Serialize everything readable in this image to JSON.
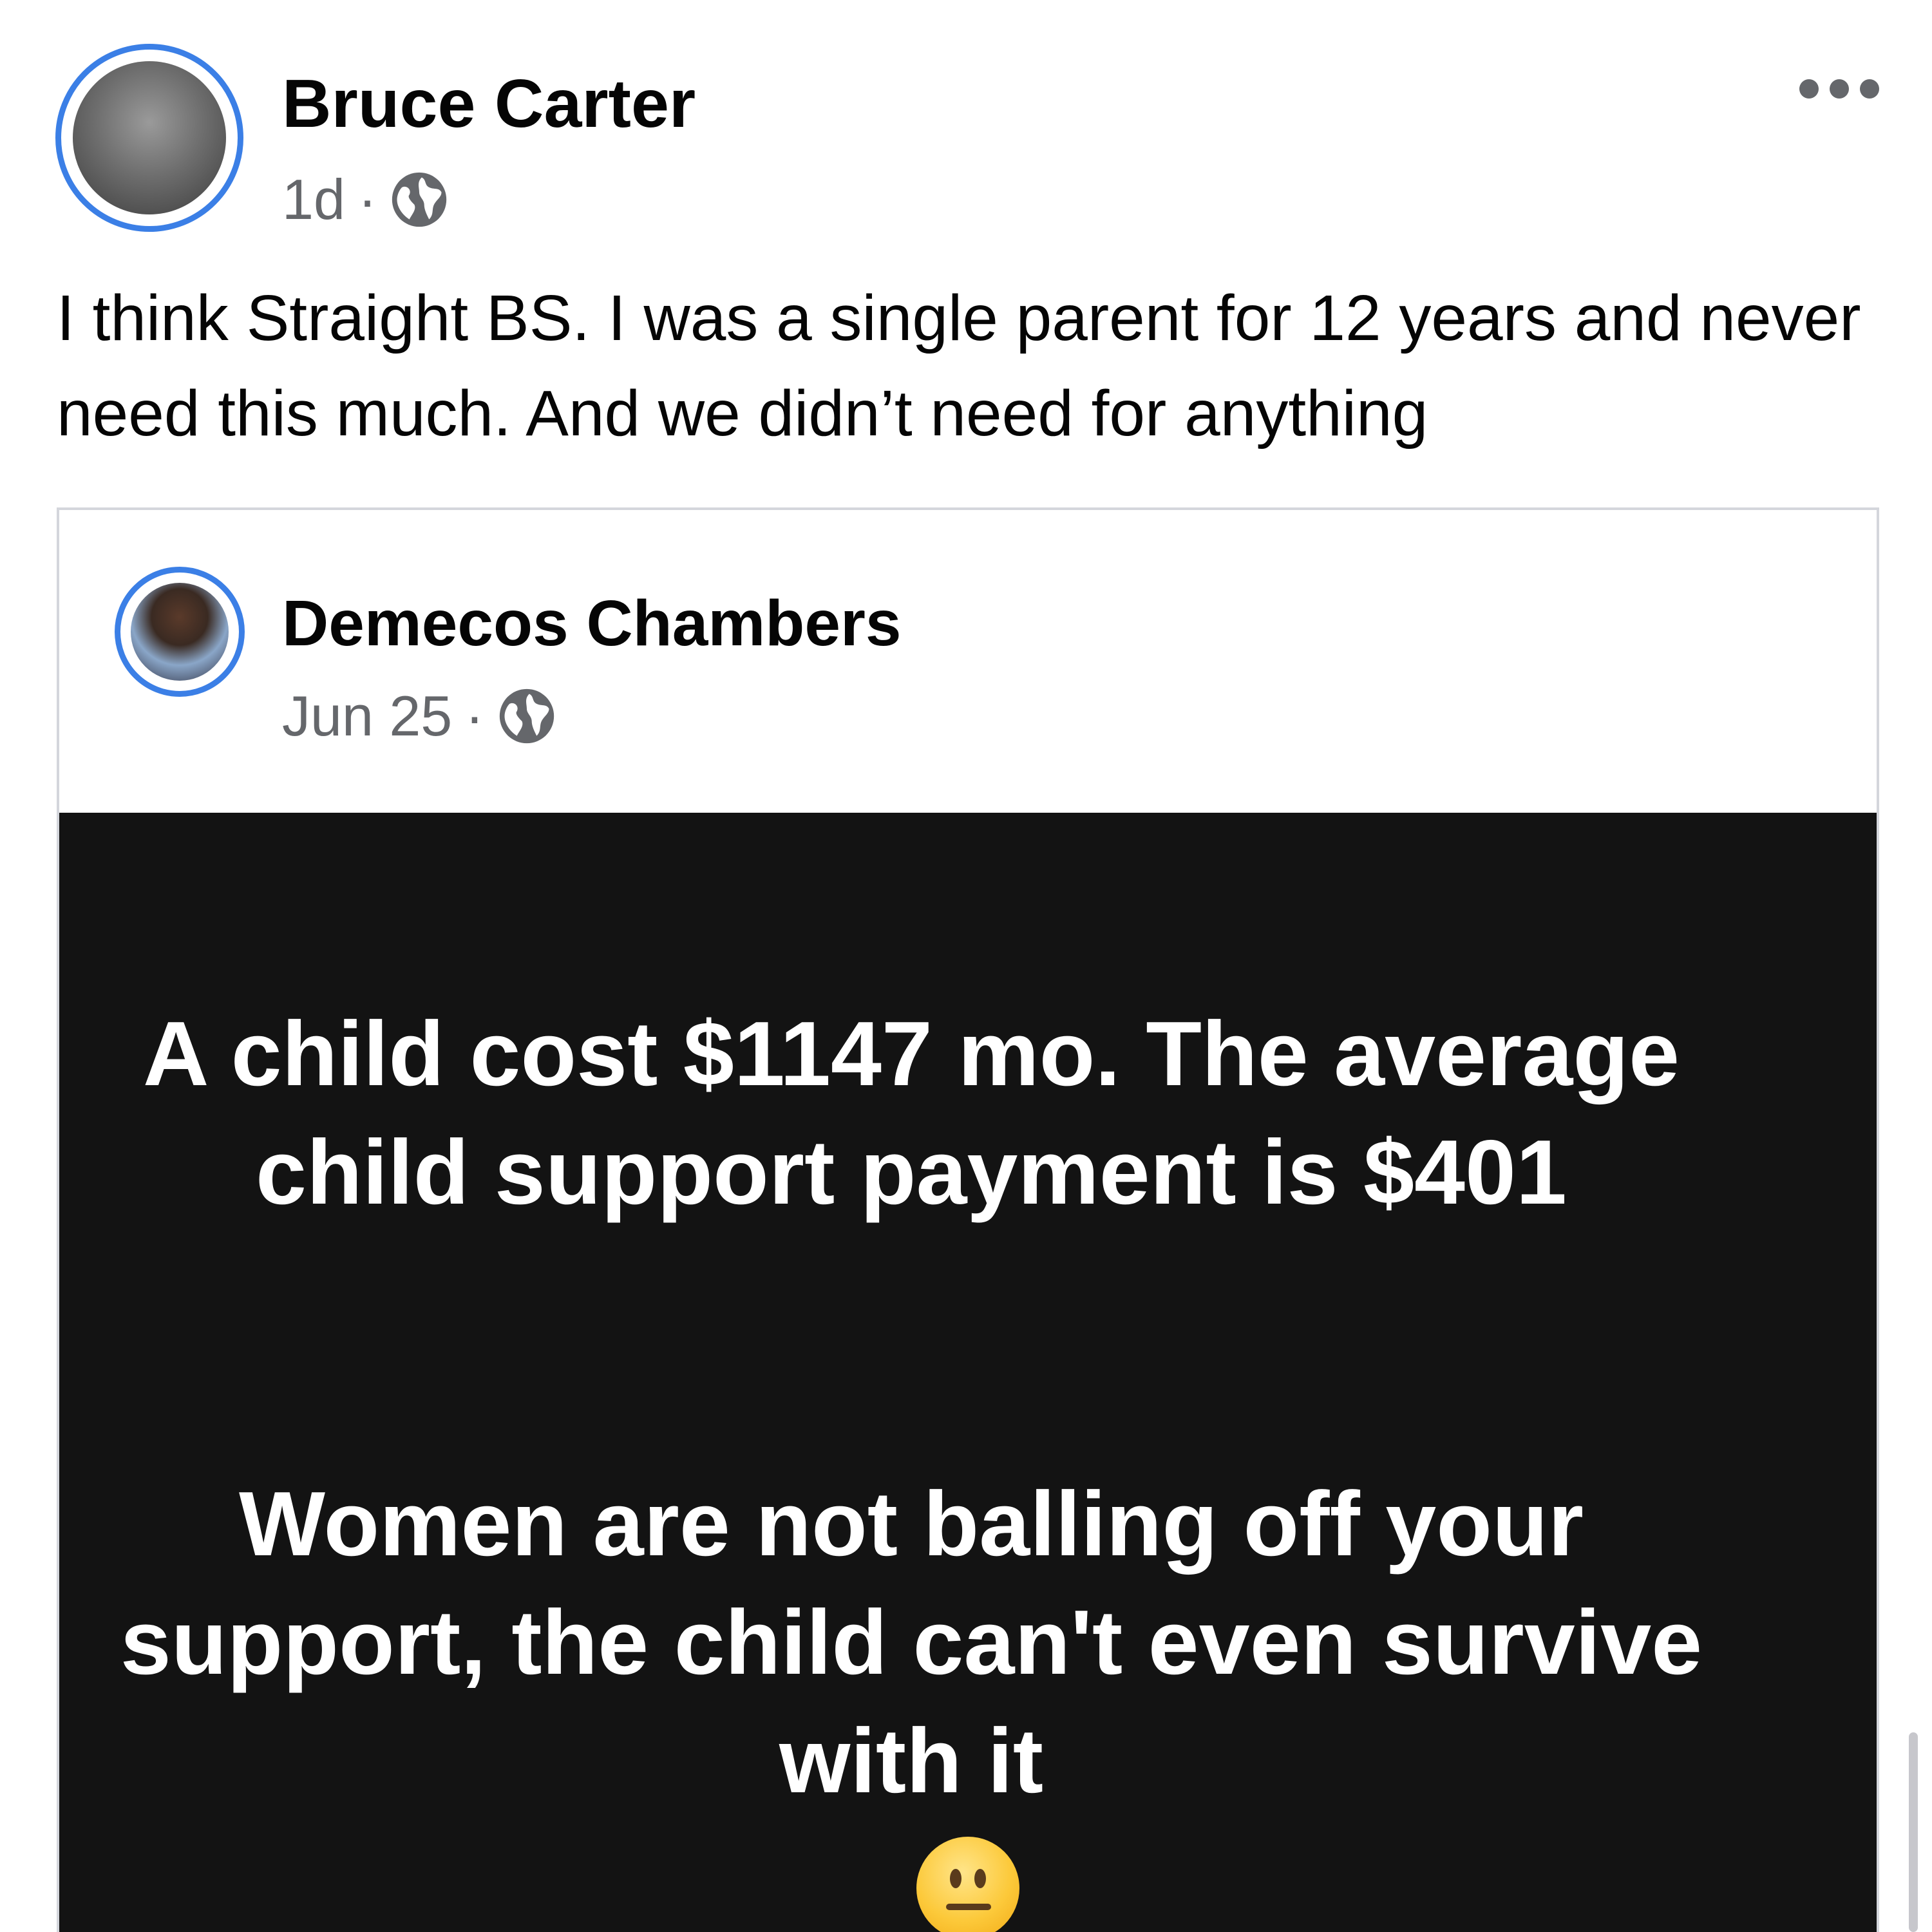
{
  "post": {
    "author": "Bruce Carter",
    "time": "1d",
    "separator": "·",
    "audience_icon": "globe-icon",
    "more_icon": "more-options-icon",
    "text": "I think Straight BS. I was a single parent for 12 years and never need this much. And we didn’t need for anything"
  },
  "shared_post": {
    "author": "Demecos Chambers",
    "time": "Jun 25",
    "separator": "·",
    "audience_icon": "globe-icon",
    "status_line_1": "A child cost $1147 mo. The average child support payment is $401",
    "status_line_2": "Women are not balling off your support, the child can't even survive with it",
    "emoji": "neutral-face-emoji",
    "background_color": "#131313"
  },
  "colors": {
    "avatar_ring": "#3b7fe6",
    "secondary_text": "#65676b",
    "primary_text": "#050505"
  }
}
